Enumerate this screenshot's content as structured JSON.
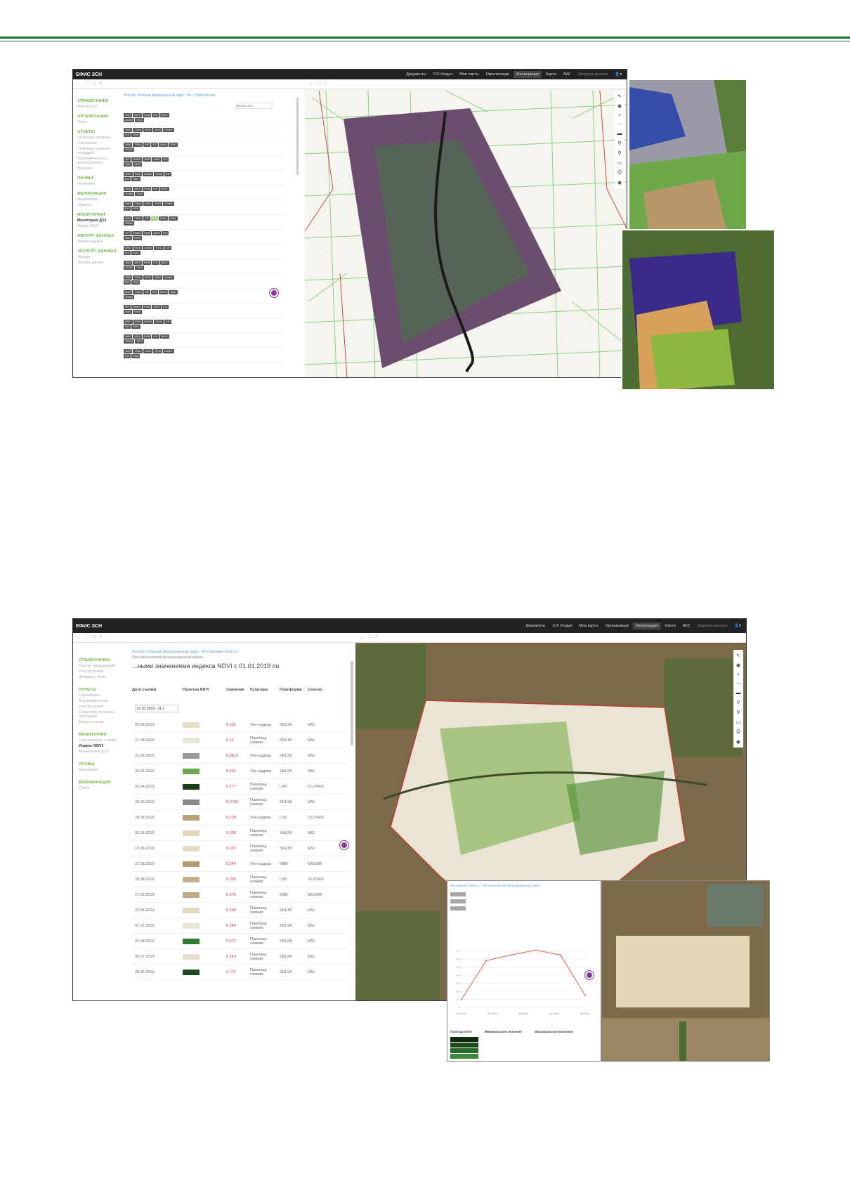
{
  "brand_color": "#1e6e35",
  "screen1": {
    "app_title": "ЕФИС ЗСН",
    "nav": [
      {
        "label": "Документы"
      },
      {
        "label": "С/Х Угодья"
      },
      {
        "label": "Мои карты"
      },
      {
        "label": "Организации"
      },
      {
        "label": "Мелиорация"
      },
      {
        "label": "Карта"
      },
      {
        "label": "АКС"
      },
      {
        "label": "Загрузка данных"
      }
    ],
    "breadcrumb": "Россия › Южный федеральный округ › Бе › Поиск Космо",
    "sidebar": [
      {
        "heading": "СПРАВОЧНИКИ",
        "items": [
          "Реестр ЗСН"
        ]
      },
      {
        "heading": "ОРГАНИЗАЦИИ",
        "items": [
          "Поиск"
        ]
      },
      {
        "heading": "ОТЧЕТЫ",
        "items": [
          "Структура посевных",
          "Севооборот",
          "Структура посевных площадей",
          "Агрохимическое и мелиоративное",
          "Выгрузки"
        ]
      },
      {
        "heading": "ПОЧВЫ",
        "items": [
          "Агрохимия"
        ]
      },
      {
        "heading": "МЕЛИОРАЦИЯ",
        "items": [
          "Мелиорация",
          "Объекты"
        ]
      },
      {
        "heading": "МОНИТОРИНГ",
        "items": [
          "Мониторинг ДЗЗ",
          "Индекс NDVI"
        ]
      },
      {
        "heading": "ИМПОРТ ДАННЫХ",
        "items": [
          "Импорт данных"
        ]
      },
      {
        "heading": "ЭКСПОРТ ДАННЫХ",
        "items": [
          "Экспорт",
          "Экспорт данных"
        ]
      }
    ],
    "search_placeholder": "Искать все"
  },
  "screen2": {
    "app_title": "ЕФИС ЗСН",
    "nav": [
      {
        "label": "Документы"
      },
      {
        "label": "С/Х Угодья"
      },
      {
        "label": "Мои карты"
      },
      {
        "label": "Организации"
      },
      {
        "label": "Мелиорация"
      },
      {
        "label": "Карта"
      },
      {
        "label": "АКС"
      },
      {
        "label": "Загрузка данных"
      }
    ],
    "breadcrumb": "Россия › Южный федеральный округ › Ростовская область",
    "breadcrumb2": "Песчанокопский муниципальный район",
    "table_title": "...ными значениями индекса NDVI с 01.01.2019 по",
    "columns": [
      "Дата съемки",
      "Палитра NDVI",
      "Значение",
      "Культура",
      "Платформа",
      "Сенсор"
    ],
    "date_filter": "01.01.2019 - 31.1",
    "sidebar": [
      {
        "heading": "СПРАВОЧНИКИ",
        "items": [
          "Реестр организаций",
          "Реестр полей",
          "Добавить поле"
        ]
      },
      {
        "heading": "ОТЧЕТЫ",
        "items": [
          "Севооборот",
          "Агрохимические",
          "Реестр полей",
          "Структура посевных площадей",
          "Виды отчетов"
        ]
      },
      {
        "heading": "МОНИТОРИНГ",
        "items": [
          "Спутниковые снимки",
          "Индекс NDVI",
          "Мониторинг ДЗЗ"
        ]
      },
      {
        "heading": "ПОЧВЫ",
        "items": [
          "Агрохимия"
        ]
      },
      {
        "heading": "ВЕРИФИКАЦИЯ",
        "items": [
          "Поиск"
        ]
      }
    ],
    "rows": [
      {
        "date": "26.08.2019",
        "value": "0.118",
        "crop": "Лен-кудряш",
        "platform": "SNL2A",
        "sensor": "MSI",
        "color": "#e7dcc8"
      },
      {
        "date": "21.08.2019",
        "value": "0.12",
        "crop": "Пшеница озимая",
        "platform": "SNL2B",
        "sensor": "MSI",
        "color": "#ece4d4"
      },
      {
        "date": "21.06.2019",
        "value": "0.0819",
        "crop": "Лен-кудряш",
        "platform": "SNL2B",
        "sensor": "MSI",
        "color": "#9a9a9a"
      },
      {
        "date": "26.05.2019",
        "value": "0.491",
        "crop": "Лен-кудряш",
        "platform": "SNL2A",
        "sensor": "MSI",
        "color": "#6aa84f"
      },
      {
        "date": "25.04.2019",
        "value": "0.777",
        "crop": "Пшеница озимая",
        "platform": "LS8",
        "sensor": "OLI/TIRS",
        "color": "#1e3d1e"
      },
      {
        "date": "28.05.2019",
        "value": "0.0799",
        "crop": "Пшеница озимая",
        "platform": "SNL2A",
        "sensor": "MSI",
        "color": "#8a8a8a"
      },
      {
        "date": "28.08.2019",
        "value": "0.218",
        "crop": "Лен-кудряш",
        "platform": "LS8",
        "sensor": "OLI/TIRS",
        "color": "#b9a07a"
      },
      {
        "date": "26.05.2019",
        "value": "0.108",
        "crop": "Пшеница озимая",
        "platform": "SNL2A",
        "sensor": "MSI",
        "color": "#e2d4bb"
      },
      {
        "date": "13.08.2019",
        "value": "0.157",
        "crop": "Пшеница озимая",
        "platform": "SNL2B",
        "sensor": "MSI",
        "color": "#e5dac6"
      },
      {
        "date": "27.08.2019",
        "value": "0.246",
        "crop": "Лен-кудряш",
        "platform": "MM2",
        "sensor": "MSUMR",
        "color": "#b59a72"
      },
      {
        "date": "28.08.2019",
        "value": "0.253",
        "crop": "Пшеница озимая",
        "platform": "LS8",
        "sensor": "OLI/TIRS",
        "color": "#c6b08c"
      },
      {
        "date": "27.08.2019",
        "value": "0.275",
        "crop": "Пшеница озимая",
        "platform": "MM2",
        "sensor": "MSUMR",
        "color": "#c0a882"
      },
      {
        "date": "22.08.2019",
        "value": "0.148",
        "crop": "Пшеница озимая",
        "platform": "SNL2B",
        "sensor": "MSI",
        "color": "#e2d6c0"
      },
      {
        "date": "07.07.2019",
        "value": "0.144",
        "crop": "Пшеница озимая",
        "platform": "SNL2A",
        "sensor": "MSI",
        "color": "#ece4d2"
      },
      {
        "date": "07.08.2019",
        "value": "0.672",
        "crop": "Пшеница озимая",
        "platform": "SNL2A",
        "sensor": "MSI",
        "color": "#2e7d2e"
      },
      {
        "date": "05.07.2019",
        "value": "0.143",
        "crop": "Пшеница озимая",
        "platform": "SNL2A",
        "sensor": "MSI",
        "color": "#e8dfcc"
      },
      {
        "date": "28.05.2019",
        "value": "0.772",
        "crop": "Пшеница озимая",
        "platform": "SNL2A",
        "sensor": "MSI",
        "color": "#1f4a1f"
      }
    ]
  },
  "chart_popup": {
    "breadcrumb": "Ростовская область › Песчанокопский муниципальный район",
    "legend_header": [
      "Палитра NDVI",
      "Минимальное значение",
      "Максимальное значение"
    ],
    "chart_data": {
      "type": "line",
      "x": [
        "04.2019",
        "05.2019",
        "06.2019",
        "07.2019",
        "08.2019"
      ],
      "values": [
        0.1,
        0.58,
        0.65,
        0.71,
        0.65,
        0.15
      ],
      "ylim": [
        0,
        0.8
      ],
      "yticks": [
        "0",
        "0.1",
        "0.2",
        "0.3",
        "0.4",
        "0.5",
        "0.6",
        "0.7"
      ],
      "line_color": "#e06050"
    }
  }
}
